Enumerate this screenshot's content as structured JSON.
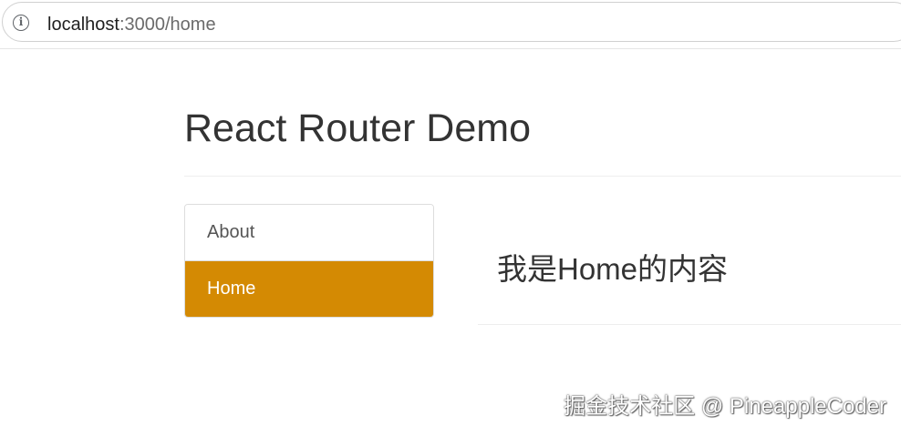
{
  "browser": {
    "url_host": "localhost",
    "url_path": ":3000/home",
    "info_icon": "info-icon"
  },
  "header": {
    "title": "React Router Demo"
  },
  "nav": {
    "items": [
      {
        "label": "About",
        "active": false
      },
      {
        "label": "Home",
        "active": true
      }
    ],
    "active_color": "#d48a03"
  },
  "content": {
    "heading": "我是Home的内容"
  },
  "watermark": {
    "text": "掘金技术社区 @ PineappleCoder"
  }
}
